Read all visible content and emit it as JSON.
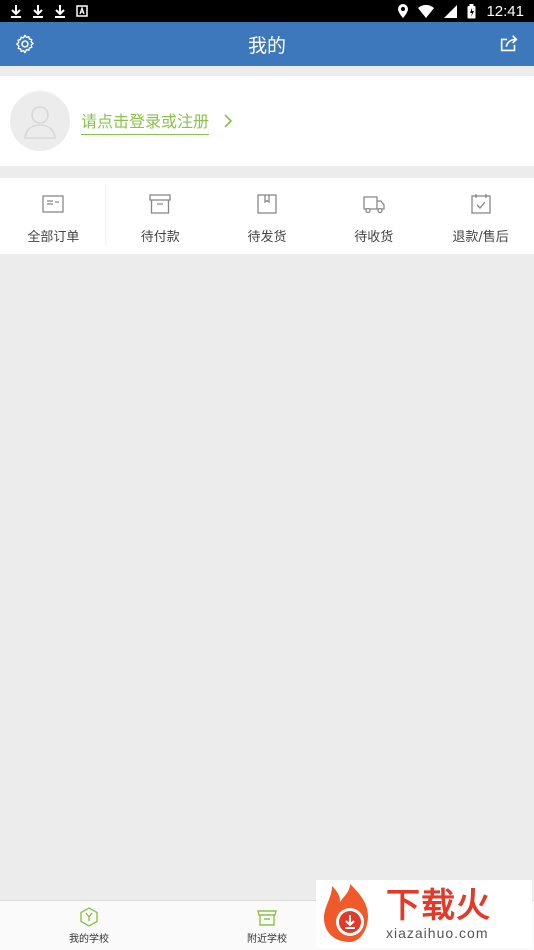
{
  "status_bar": {
    "time": "12:41"
  },
  "header": {
    "title": "我的",
    "settings_icon": "gear-icon",
    "share_icon": "share-icon",
    "color": "#3d78bd"
  },
  "profile": {
    "login_text": "请点击登录或注册",
    "accent": "#8bc34a"
  },
  "orders": [
    {
      "label": "全部订单",
      "icon": "all-orders-icon"
    },
    {
      "label": "待付款",
      "icon": "pending-payment-icon"
    },
    {
      "label": "待发货",
      "icon": "pending-shipment-icon"
    },
    {
      "label": "待收货",
      "icon": "pending-receipt-icon"
    },
    {
      "label": "退款/售后",
      "icon": "refund-icon"
    }
  ],
  "tabs": [
    {
      "label": "我的学校",
      "icon": "my-school-icon"
    },
    {
      "label": "附近学校",
      "icon": "nearby-school-icon"
    }
  ],
  "watermark": {
    "brand": "下载火",
    "url": "xiazaihuo.com"
  }
}
